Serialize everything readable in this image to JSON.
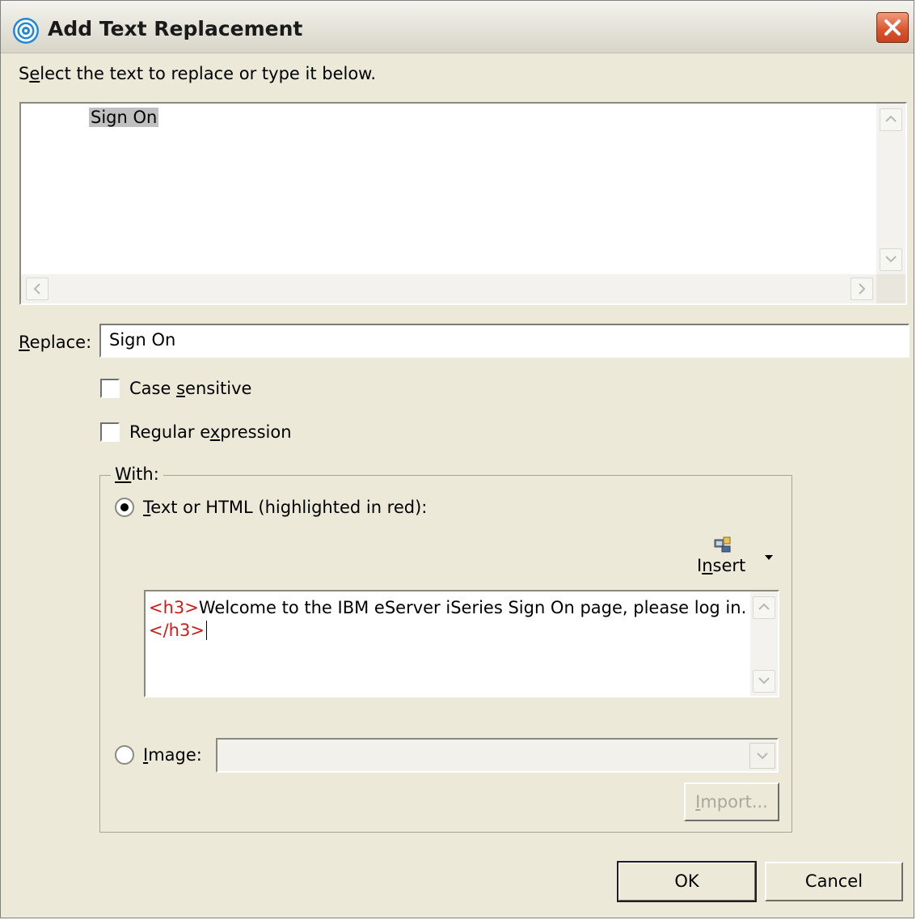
{
  "window": {
    "title": "Add Text Replacement"
  },
  "instruction": {
    "label_prefix": "S",
    "label_underlined": "e",
    "label_rest": "lect the text to replace or type it below."
  },
  "preview": {
    "selected_text": "Sign On"
  },
  "replace": {
    "label_underlined": "R",
    "label_rest": "eplace:",
    "value": "Sign On"
  },
  "options": {
    "case_sensitive": {
      "label_prefix": "Case ",
      "label_underlined": "s",
      "label_rest": "ensitive",
      "checked": false
    },
    "regular_expression": {
      "label_prefix": "Regular e",
      "label_underlined": "x",
      "label_rest": "pression",
      "checked": false
    }
  },
  "with_group": {
    "legend_underlined": "W",
    "legend_rest": "ith:",
    "text_option": {
      "label_underlined": "T",
      "label_rest": "ext or HTML (highlighted in red):",
      "selected": true
    },
    "insert": {
      "label_prefix": "I",
      "label_underlined": "n",
      "label_rest": "sert",
      "icon": "insert-icon"
    },
    "html": {
      "open_tag": "<h3>",
      "content": "Welcome to the IBM eServer iSeries Sign On page, please log in.",
      "close_tag": "</h3>",
      "tag_color": "#d11a1a"
    },
    "image_option": {
      "label_underlined": "I",
      "label_rest": "mage:",
      "selected": false,
      "value": ""
    },
    "import_button": {
      "label_underlined": "I",
      "label_rest": "mport..."
    }
  },
  "buttons": {
    "ok": "OK",
    "cancel": "Cancel"
  }
}
